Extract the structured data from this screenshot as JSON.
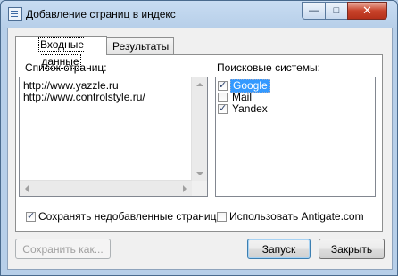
{
  "window": {
    "title": "Добавление страниц в индекс"
  },
  "controls": {
    "minimize": "—",
    "maximize": "□",
    "close": "✕"
  },
  "tabs": [
    {
      "label": "Входные данные",
      "active": true
    },
    {
      "label": "Результаты",
      "active": false
    }
  ],
  "pages": {
    "label": "Список страниц:",
    "lines": [
      "http://www.yazzle.ru",
      "http://www.controlstyle.ru/"
    ]
  },
  "engines": {
    "label": "Поисковые системы:",
    "items": [
      {
        "label": "Google",
        "checked": true,
        "selected": true
      },
      {
        "label": "Mail",
        "checked": false,
        "selected": false
      },
      {
        "label": "Yandex",
        "checked": true,
        "selected": false
      }
    ]
  },
  "options": {
    "keep_unadded": {
      "label": "Сохранять недобавленные страницы",
      "checked": true
    },
    "use_antigate": {
      "label": "Использовать Antigate.com",
      "checked": false
    }
  },
  "buttons": {
    "save_as": "Сохранить как...",
    "run": "Запуск",
    "close": "Закрыть"
  }
}
